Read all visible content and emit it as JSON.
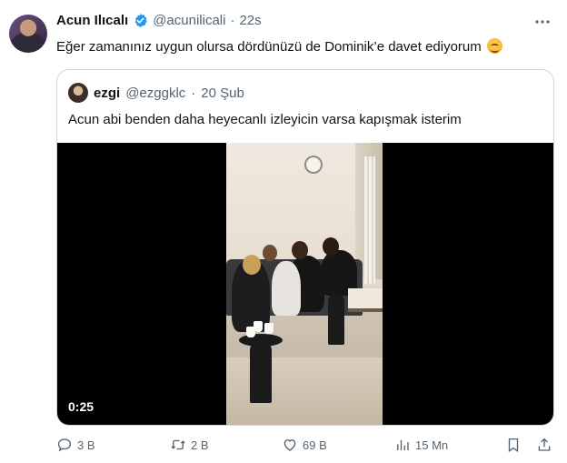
{
  "author": {
    "name": "Acun Ilıcalı",
    "handle": "@acunilicali",
    "separator": "·",
    "time": "22s"
  },
  "tweet": {
    "text": "Eğer zamanınız uygun olursa dördünüzü de Dominik’e davet ediyorum"
  },
  "quoted": {
    "name": "ezgi",
    "handle": "@ezggklc",
    "separator": "·",
    "time": "20 Şub",
    "text": "Acun abi benden daha heyecanlı izleyicin varsa kapışmak isterim",
    "video_time": "0:25"
  },
  "actions": {
    "replies": "3 B",
    "retweets": "2 B",
    "likes": "69 B",
    "views": "15 Mn"
  },
  "colors": {
    "verified": "#1d9bf0",
    "secondary_text": "#536471",
    "border": "#cfd9de"
  },
  "icons": [
    "verified-badge-icon",
    "more-icon",
    "reply-icon",
    "retweet-icon",
    "like-icon",
    "views-icon",
    "bookmark-icon",
    "share-icon",
    "smiling-emoji-icon"
  ]
}
